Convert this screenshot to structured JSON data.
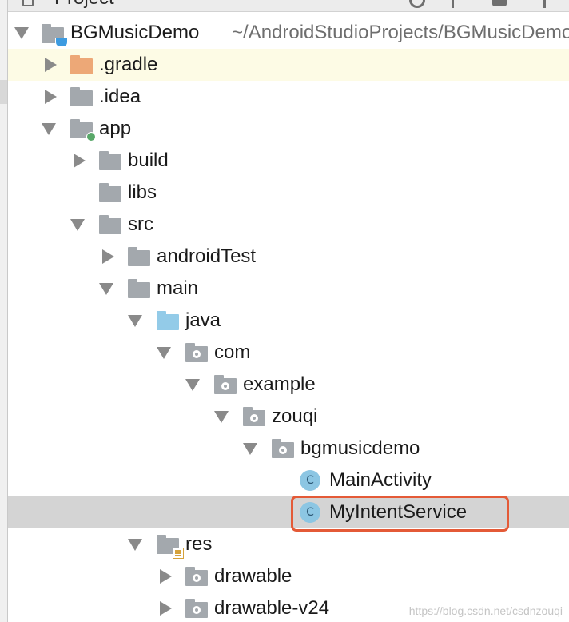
{
  "panel": {
    "header_label": "Project"
  },
  "tree": {
    "root": {
      "label": "BGMusicDemo",
      "path": "~/AndroidStudioProjects/BGMusicDemo"
    },
    "gradle": {
      "label": ".gradle"
    },
    "idea": {
      "label": ".idea"
    },
    "app": {
      "label": "app"
    },
    "build": {
      "label": "build"
    },
    "libs": {
      "label": "libs"
    },
    "src": {
      "label": "src"
    },
    "android_test": {
      "label": "androidTest"
    },
    "main": {
      "label": "main"
    },
    "java": {
      "label": "java"
    },
    "com": {
      "label": "com"
    },
    "example": {
      "label": "example"
    },
    "zouqi": {
      "label": "zouqi"
    },
    "bgmusicdemo": {
      "label": "bgmusicdemo"
    },
    "main_activity": {
      "label": "MainActivity",
      "badge": "C"
    },
    "my_intent_service": {
      "label": "MyIntentService",
      "badge": "C"
    },
    "res": {
      "label": "res"
    },
    "drawable": {
      "label": "drawable"
    },
    "drawable_v24": {
      "label": "drawable-v24"
    }
  },
  "watermark": "https://blog.csdn.net/csdnzouqi",
  "colors": {
    "selection_outline": "#e45a37",
    "selected_row": "#d4d4d4",
    "hover_row": "#fdfbe5",
    "folder_gray": "#a3a8ad",
    "folder_orange": "#eda877",
    "folder_blue": "#93cbe8",
    "class_badge": "#8cc6e3"
  }
}
